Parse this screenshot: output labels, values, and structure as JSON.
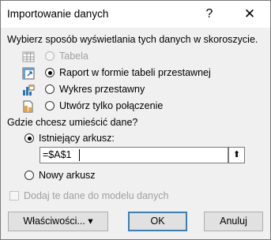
{
  "window": {
    "title": "Importowanie danych",
    "help_glyph": "?",
    "close_glyph": "✕"
  },
  "view_section": {
    "heading": "Wybierz sposób wyświetlania tych danych w skoroszycie.",
    "options": [
      {
        "label": "Tabela",
        "selected": false,
        "enabled": false,
        "icon": "table-icon"
      },
      {
        "label": "Raport w formie tabeli przestawnej",
        "selected": true,
        "enabled": true,
        "icon": "pivot-table-icon"
      },
      {
        "label": "Wykres przestawny",
        "selected": false,
        "enabled": true,
        "icon": "pivot-chart-icon"
      },
      {
        "label": "Utwórz tylko połączenie",
        "selected": false,
        "enabled": true,
        "icon": "connection-only-icon"
      }
    ]
  },
  "location_section": {
    "heading": "Gdzie chcesz umieścić dane?",
    "existing_sheet_label": "Istniejący arkusz:",
    "existing_sheet_selected": true,
    "cell_reference": "=$A$1",
    "collapse_button_glyph": "⬆",
    "new_sheet_label": "Nowy arkusz",
    "new_sheet_selected": false
  },
  "data_model": {
    "label": "Dodaj te dane do modelu danych",
    "checked": false,
    "enabled": false
  },
  "buttons": {
    "properties": "Właściwości... ▾",
    "ok": "OK",
    "cancel": "Anuluj"
  },
  "colors": {
    "default_button_border": "#3c7fb1",
    "disabled_text": "#a0a0a0",
    "dialog_background": "#f0f0f0"
  }
}
